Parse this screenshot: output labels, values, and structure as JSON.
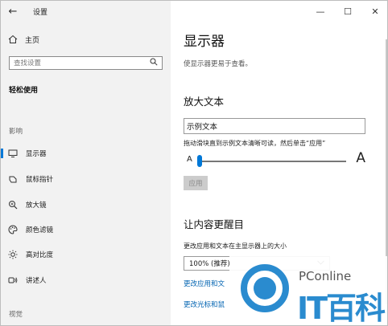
{
  "window": {
    "title": "设置",
    "controls": {
      "minimize": "—",
      "maximize": "☐",
      "close": "✕"
    }
  },
  "sidebar": {
    "back_icon": "back-arrow-icon",
    "home_label": "主页",
    "search_placeholder": "查找设置",
    "section_title": "轻松使用",
    "group_vision": "影响",
    "items": [
      {
        "label": "显示器",
        "icon": "display-icon",
        "selected": true
      },
      {
        "label": "鼠标指针",
        "icon": "pointer-icon",
        "selected": false
      },
      {
        "label": "放大镜",
        "icon": "magnifier-icon",
        "selected": false
      },
      {
        "label": "颜色滤镜",
        "icon": "palette-icon",
        "selected": false
      },
      {
        "label": "高对比度",
        "icon": "brightness-icon",
        "selected": false
      },
      {
        "label": "讲述人",
        "icon": "narrator-icon",
        "selected": false
      }
    ],
    "group_bottom": "视觉"
  },
  "main": {
    "title": "显示器",
    "description": "使显示器更易于查看。",
    "text_section": {
      "heading": "放大文本",
      "sample_text": "示例文本",
      "hint": "拖动滑块直到示例文本清晰可读，然后单击“应用”",
      "slider_min_label": "A",
      "slider_max_label": "A",
      "slider_value_percent": 0,
      "apply_label": "应用"
    },
    "bigger_section": {
      "heading": "让内容更醒目",
      "size_label": "更改应用和文本在主显示器上的大小",
      "size_value": "100% (推荐)",
      "link1": "更改应用和文",
      "link2": "更改光标和鼠"
    }
  },
  "watermark": {
    "site": "PConline",
    "brand": "IT百科"
  },
  "colors": {
    "accent": "#0078d7",
    "sidebar_bg": "#f2f2f2",
    "watermark_blue": "#2a8bcf"
  }
}
